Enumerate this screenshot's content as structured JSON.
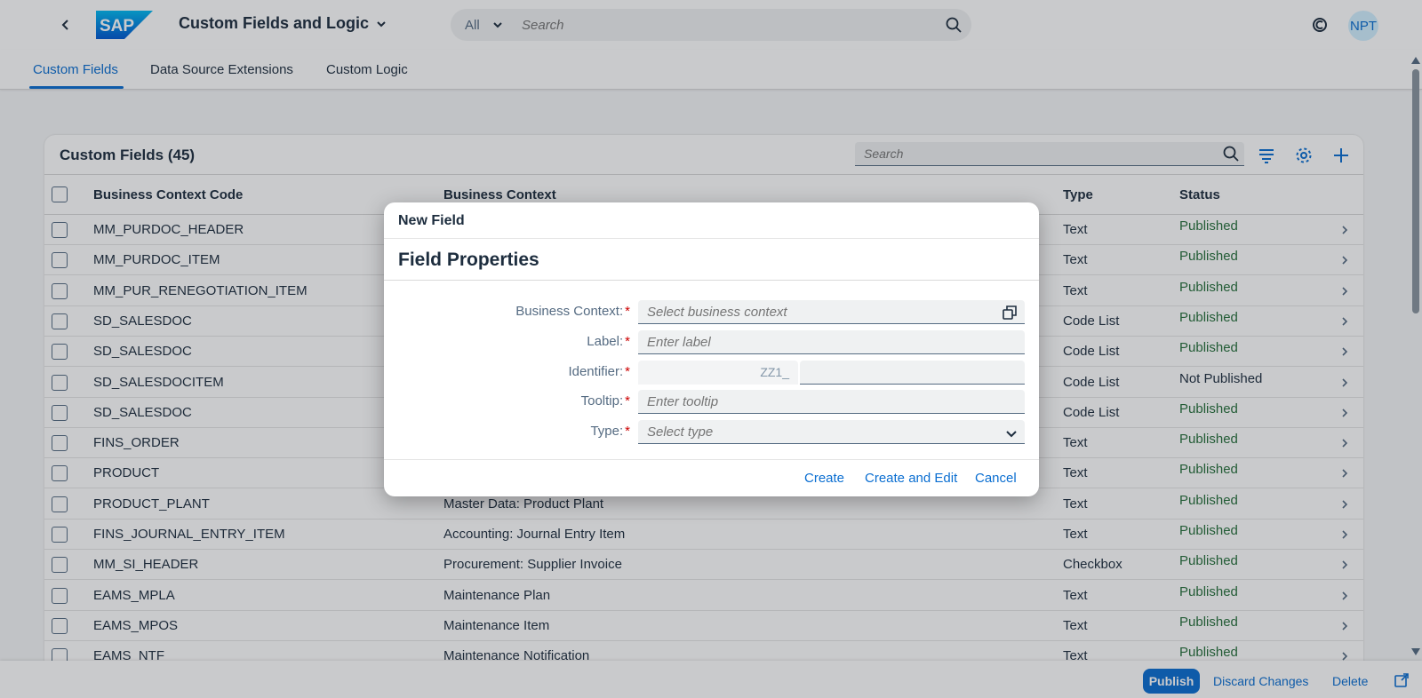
{
  "shell": {
    "app_title": "Custom Fields and Logic",
    "search_scope": "All",
    "search_placeholder": "Search",
    "avatar_initials": "NPT",
    "logo_text": "SAP"
  },
  "tabs": [
    {
      "label": "Custom Fields",
      "active": true
    },
    {
      "label": "Data Source Extensions",
      "active": false
    },
    {
      "label": "Custom Logic",
      "active": false
    }
  ],
  "table": {
    "title": "Custom Fields (45)",
    "search_placeholder": "Search",
    "columns": [
      "Business Context Code",
      "Business Context",
      "Type",
      "Status"
    ],
    "rows": [
      {
        "code": "MM_PURDOC_HEADER",
        "context": "",
        "type": "Text",
        "status": "Published"
      },
      {
        "code": "MM_PURDOC_ITEM",
        "context": "",
        "type": "Text",
        "status": "Published"
      },
      {
        "code": "MM_PUR_RENEGOTIATION_ITEM",
        "context": "",
        "type": "Text",
        "status": "Published"
      },
      {
        "code": "SD_SALESDOC",
        "context": "",
        "type": "Code List",
        "status": "Published"
      },
      {
        "code": "SD_SALESDOC",
        "context": "",
        "type": "Code List",
        "status": "Published"
      },
      {
        "code": "SD_SALESDOCITEM",
        "context": "",
        "type": "Code List",
        "status": "Not Published"
      },
      {
        "code": "SD_SALESDOC",
        "context": "",
        "type": "Code List",
        "status": "Published"
      },
      {
        "code": "FINS_ORDER",
        "context": "",
        "type": "Text",
        "status": "Published"
      },
      {
        "code": "PRODUCT",
        "context": "",
        "type": "Text",
        "status": "Published"
      },
      {
        "code": "PRODUCT_PLANT",
        "context": "Master Data: Product Plant",
        "type": "Text",
        "status": "Published"
      },
      {
        "code": "FINS_JOURNAL_ENTRY_ITEM",
        "context": "Accounting: Journal Entry Item",
        "type": "Text",
        "status": "Published"
      },
      {
        "code": "MM_SI_HEADER",
        "context": "Procurement: Supplier Invoice",
        "type": "Checkbox",
        "status": "Published"
      },
      {
        "code": "EAMS_MPLA",
        "context": "Maintenance Plan",
        "type": "Text",
        "status": "Published"
      },
      {
        "code": "EAMS_MPOS",
        "context": "Maintenance Item",
        "type": "Text",
        "status": "Published"
      },
      {
        "code": "EAMS_NTF",
        "context": "Maintenance Notification",
        "type": "Text",
        "status": "Published"
      }
    ]
  },
  "footer": {
    "publish": "Publish",
    "discard": "Discard Changes",
    "delete": "Delete"
  },
  "dialog": {
    "title": "New Field",
    "section": "Field Properties",
    "fields": {
      "business_context": {
        "label": "Business Context:",
        "placeholder": "Select business context"
      },
      "label": {
        "label": "Label:",
        "placeholder": "Enter label"
      },
      "identifier": {
        "label": "Identifier:",
        "prefix": "ZZ1_"
      },
      "tooltip": {
        "label": "Tooltip:",
        "placeholder": "Enter tooltip"
      },
      "type": {
        "label": "Type:",
        "placeholder": "Select type"
      }
    },
    "required_marker": "*",
    "buttons": {
      "create": "Create",
      "create_edit": "Create and Edit",
      "cancel": "Cancel"
    }
  },
  "colors": {
    "accent": "#0a6ed1",
    "published": "#256f3a",
    "not_published": "#1d2d3e"
  }
}
